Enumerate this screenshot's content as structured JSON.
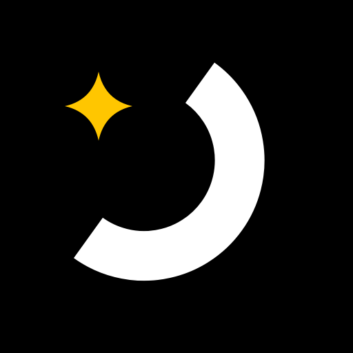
{
  "logo": {
    "icon_name": "crescent-arc-with-sparkle-icon",
    "colors": {
      "background": "#000000",
      "arc": "#FFFFFF",
      "sparkle": "#FFC600"
    }
  }
}
